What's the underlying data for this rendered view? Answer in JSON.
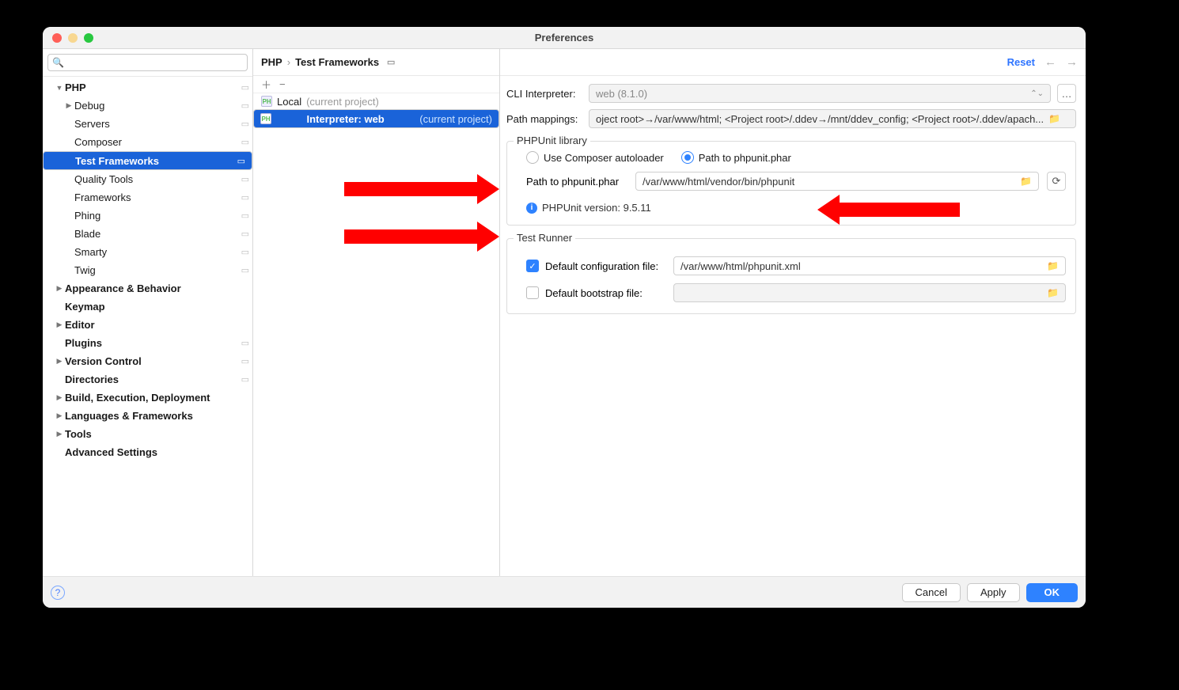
{
  "window_title": "Preferences",
  "search_placeholder": "",
  "sidebar": [
    {
      "label": "PHP",
      "bold": true,
      "disc": "down",
      "gear": true,
      "ind": 0
    },
    {
      "label": "Debug",
      "disc": "right",
      "gear": true,
      "ind": 1
    },
    {
      "label": "Servers",
      "gear": true,
      "ind": 2
    },
    {
      "label": "Composer",
      "gear": true,
      "ind": 2
    },
    {
      "label": "Test Frameworks",
      "gear": true,
      "ind": 2,
      "selected": true
    },
    {
      "label": "Quality Tools",
      "gear": true,
      "ind": 2
    },
    {
      "label": "Frameworks",
      "gear": true,
      "ind": 2
    },
    {
      "label": "Phing",
      "gear": true,
      "ind": 2
    },
    {
      "label": "Blade",
      "gear": true,
      "ind": 2
    },
    {
      "label": "Smarty",
      "gear": true,
      "ind": 2
    },
    {
      "label": "Twig",
      "gear": true,
      "ind": 2
    },
    {
      "label": "Appearance & Behavior",
      "bold": true,
      "disc": "right",
      "ind": 0
    },
    {
      "label": "Keymap",
      "bold": true,
      "ind": 0,
      "pad": true
    },
    {
      "label": "Editor",
      "bold": true,
      "disc": "right",
      "ind": 0
    },
    {
      "label": "Plugins",
      "bold": true,
      "gear": true,
      "ind": 0,
      "pad": true
    },
    {
      "label": "Version Control",
      "bold": true,
      "disc": "right",
      "gear": true,
      "ind": 0
    },
    {
      "label": "Directories",
      "bold": true,
      "gear": true,
      "ind": 0,
      "pad": true
    },
    {
      "label": "Build, Execution, Deployment",
      "bold": true,
      "disc": "right",
      "ind": 0
    },
    {
      "label": "Languages & Frameworks",
      "bold": true,
      "disc": "right",
      "ind": 0
    },
    {
      "label": "Tools",
      "bold": true,
      "disc": "right",
      "ind": 0
    },
    {
      "label": "Advanced Settings",
      "bold": true,
      "ind": 0,
      "pad": true
    }
  ],
  "breadcrumb": {
    "a": "PHP",
    "b": "Test Frameworks"
  },
  "midlist": [
    {
      "name": "Local",
      "hint": "(current project)",
      "selected": false
    },
    {
      "name": "Interpreter: web",
      "hint": "(current project)",
      "selected": true
    }
  ],
  "cli": {
    "label": "CLI Interpreter:",
    "value": "web (8.1.0)"
  },
  "mappings": {
    "label": "Path mappings:",
    "value": "oject root>→/var/www/html; <Project root>/.ddev→/mnt/ddev_config; <Project root>/.ddev/apach..."
  },
  "phpunit": {
    "legend": "PHPUnit library",
    "r1": "Use Composer autoloader",
    "r2": "Path to phpunit.phar",
    "pathlabel": "Path to phpunit.phar",
    "pathvalue": "/var/www/html/vendor/bin/phpunit",
    "version": "PHPUnit version: 9.5.11"
  },
  "runner": {
    "legend": "Test Runner",
    "conf_label": "Default configuration file:",
    "conf_value": "/var/www/html/phpunit.xml",
    "boot_label": "Default bootstrap file:",
    "boot_value": ""
  },
  "reset": "Reset",
  "buttons": {
    "cancel": "Cancel",
    "apply": "Apply",
    "ok": "OK"
  }
}
